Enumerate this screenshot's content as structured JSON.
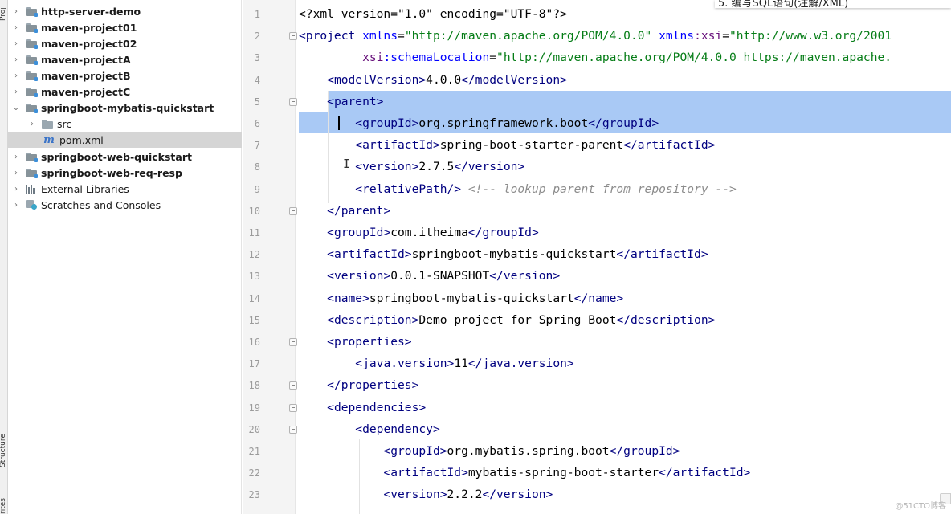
{
  "tool_strip": {
    "project_label": "Proj",
    "structure_label": "Structure",
    "favorites_label": "rites"
  },
  "tree": {
    "items": [
      {
        "label": "http-server-demo"
      },
      {
        "label": "maven-project01"
      },
      {
        "label": "maven-project02"
      },
      {
        "label": "maven-projectA"
      },
      {
        "label": "maven-projectB"
      },
      {
        "label": "maven-projectC"
      },
      {
        "label": "springboot-mybatis-quickstart"
      },
      {
        "label": "src"
      },
      {
        "label": "pom.xml",
        "icon": "m"
      },
      {
        "label": "springboot-web-quickstart"
      },
      {
        "label": "springboot-web-req-resp"
      },
      {
        "label": "External Libraries"
      },
      {
        "label": "Scratches and Consoles"
      }
    ]
  },
  "editor": {
    "line_numbers": [
      "1",
      "2",
      "3",
      "4",
      "5",
      "6",
      "7",
      "8",
      "9",
      "10",
      "11",
      "12",
      "13",
      "14",
      "15",
      "16",
      "17",
      "18",
      "19",
      "20",
      "21",
      "22",
      "23"
    ],
    "lines": [
      [
        [
          "",
          "<?xml version=\"1.0\" encoding=\"UTF-8\"?>"
        ]
      ],
      [
        [
          "t",
          "<project "
        ],
        [
          "ak",
          "xmlns"
        ],
        [
          "",
          "="
        ],
        [
          "av",
          "\"http://maven.apache.org/POM/4.0.0\""
        ],
        [
          "",
          ""
        ],
        [
          "ak",
          " xmlns"
        ],
        [
          "ns",
          ":xsi"
        ],
        [
          "",
          "="
        ],
        [
          "av",
          "\"http://www.w3.org/2001"
        ]
      ],
      [
        [
          "",
          "         "
        ],
        [
          "ns",
          "xsi"
        ],
        [
          "ak",
          ":schemaLocation"
        ],
        [
          "",
          "="
        ],
        [
          "av",
          "\"http://maven.apache.org/POM/4.0.0 https://maven.apache."
        ]
      ],
      [
        [
          "",
          "    "
        ],
        [
          "t",
          "<modelVersion>"
        ],
        [
          "",
          "4.0.0"
        ],
        [
          "t",
          "</modelVersion>"
        ]
      ],
      [
        [
          "",
          "    "
        ],
        [
          "t",
          "<parent>"
        ]
      ],
      [
        [
          "",
          "        "
        ],
        [
          "t",
          "<groupId>"
        ],
        [
          "",
          "org.springframework.boot"
        ],
        [
          "t",
          "</groupId>"
        ]
      ],
      [
        [
          "",
          "        "
        ],
        [
          "t",
          "<artifactId>"
        ],
        [
          "",
          "spring-boot-starter-parent"
        ],
        [
          "t",
          "</artifactId>"
        ]
      ],
      [
        [
          "",
          "        "
        ],
        [
          "t",
          "<version>"
        ],
        [
          "",
          "2.7.5"
        ],
        [
          "t",
          "</version>"
        ]
      ],
      [
        [
          "",
          "        "
        ],
        [
          "t",
          "<relativePath/>"
        ],
        [
          "",
          " "
        ],
        [
          "cm",
          "<!-- lookup parent from repository -->"
        ]
      ],
      [
        [
          "",
          "    "
        ],
        [
          "t",
          "</parent>"
        ]
      ],
      [
        [
          "",
          "    "
        ],
        [
          "t",
          "<groupId>"
        ],
        [
          "",
          "com.itheima"
        ],
        [
          "t",
          "</groupId>"
        ]
      ],
      [
        [
          "",
          "    "
        ],
        [
          "t",
          "<artifactId>"
        ],
        [
          "",
          "springboot-mybatis-quickstart"
        ],
        [
          "t",
          "</artifactId>"
        ]
      ],
      [
        [
          "",
          "    "
        ],
        [
          "t",
          "<version>"
        ],
        [
          "",
          "0.0.1-SNAPSHOT"
        ],
        [
          "t",
          "</version>"
        ]
      ],
      [
        [
          "",
          "    "
        ],
        [
          "t",
          "<name>"
        ],
        [
          "",
          "springboot-mybatis-quickstart"
        ],
        [
          "t",
          "</name>"
        ]
      ],
      [
        [
          "",
          "    "
        ],
        [
          "t",
          "<description>"
        ],
        [
          "",
          "Demo project for Spring Boot"
        ],
        [
          "t",
          "</description>"
        ]
      ],
      [
        [
          "",
          "    "
        ],
        [
          "t",
          "<properties>"
        ]
      ],
      [
        [
          "",
          "        "
        ],
        [
          "t",
          "<java.version>"
        ],
        [
          "",
          "11"
        ],
        [
          "t",
          "</java.version>"
        ]
      ],
      [
        [
          "",
          "    "
        ],
        [
          "t",
          "</properties>"
        ]
      ],
      [
        [
          "",
          "    "
        ],
        [
          "t",
          "<dependencies>"
        ]
      ],
      [
        [
          "",
          "        "
        ],
        [
          "t",
          "<dependency>"
        ]
      ],
      [
        [
          "",
          "            "
        ],
        [
          "t",
          "<groupId>"
        ],
        [
          "",
          "org.mybatis.spring.boot"
        ],
        [
          "t",
          "</groupId>"
        ]
      ],
      [
        [
          "",
          "            "
        ],
        [
          "t",
          "<artifactId>"
        ],
        [
          "",
          "mybatis-spring-boot-starter"
        ],
        [
          "t",
          "</artifactId>"
        ]
      ],
      [
        [
          "",
          "            "
        ],
        [
          "t",
          "<version>"
        ],
        [
          "",
          "2.2.2"
        ],
        [
          "t",
          "</version>"
        ]
      ]
    ]
  },
  "overlay": {
    "text": "5.   编写SQL语句(注解/XML)"
  },
  "watermark": "@51CTO博客",
  "colors": {
    "selection": "#a9c9f5",
    "tag": "#000080",
    "attr_value": "#067d17",
    "attr_name": "#0000ff",
    "comment": "#8c8c8c"
  }
}
